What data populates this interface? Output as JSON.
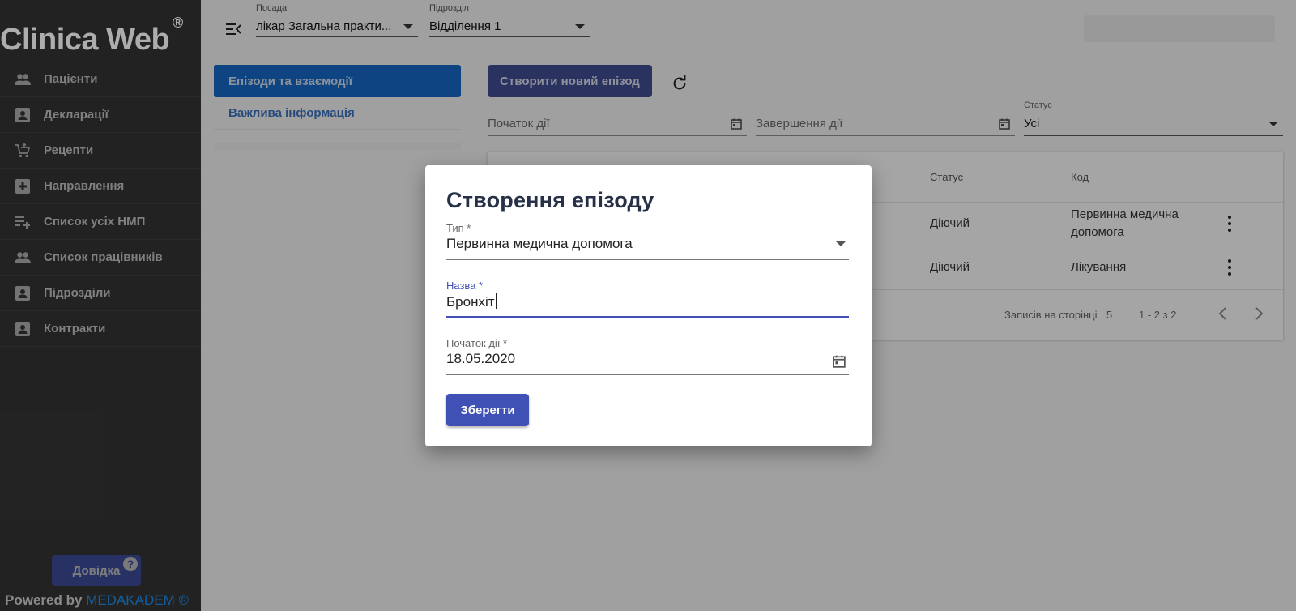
{
  "app": {
    "logo": "Clinica Web",
    "logo_mark": "®",
    "powered_prefix": "Powered by",
    "powered_brand": "MEDAKADEM ®",
    "help_label": "Довідка",
    "help_mark": "?"
  },
  "sidebar": {
    "items": [
      {
        "label": "Пацієнти",
        "icon": "people-icon"
      },
      {
        "label": "Декларації",
        "icon": "contact-card-icon"
      },
      {
        "label": "Рецепти",
        "icon": "cart-plus-icon"
      },
      {
        "label": "Направлення",
        "icon": "medical-plus-icon"
      },
      {
        "label": "Список усіх НМП",
        "icon": "playlist-add-icon"
      },
      {
        "label": "Список працівників",
        "icon": "people-icon"
      },
      {
        "label": "Підрозділи",
        "icon": "contact-card-icon"
      },
      {
        "label": "Контракти",
        "icon": "contact-card-icon"
      }
    ]
  },
  "topbar": {
    "position_label": "Посада",
    "position_value": "лікар Загальна практи...",
    "division_label": "Підрозділ",
    "division_value": "Відділення 1"
  },
  "left_panel": {
    "tab_active": "Епізоди та взаємодії",
    "tab_other": "Важлива інформація"
  },
  "main": {
    "create_label": "Створити новий епізод",
    "filter_start_placeholder": "Початок дії",
    "filter_end_placeholder": "Завершення дії",
    "status_label": "Статус",
    "status_value": "Усі",
    "table": {
      "headers": [
        "Статус",
        "Код"
      ],
      "rows": [
        {
          "status": "Діючий",
          "code_line1": "Первинна медична",
          "code_line2": "допомога"
        },
        {
          "status": "Діючий",
          "code_line1": "Лікування",
          "code_line2": ""
        }
      ],
      "rows_per_page_label": "Записів на сторінці",
      "rows_per_page_value": "5",
      "range": "1 - 2 з 2"
    }
  },
  "dialog": {
    "title": "Створення епізоду",
    "type_label": "Тип *",
    "type_value": "Первинна медична допомога",
    "name_label": "Назва *",
    "name_value": "Бронхіт",
    "start_label": "Початок дії *",
    "start_value": "18.05.2020",
    "save_label": "Зберегти"
  },
  "colors": {
    "sidebar_bg": "#333333",
    "accent": "#3f51b5",
    "tab_active": "#1565c0",
    "link": "#1e88e5"
  }
}
